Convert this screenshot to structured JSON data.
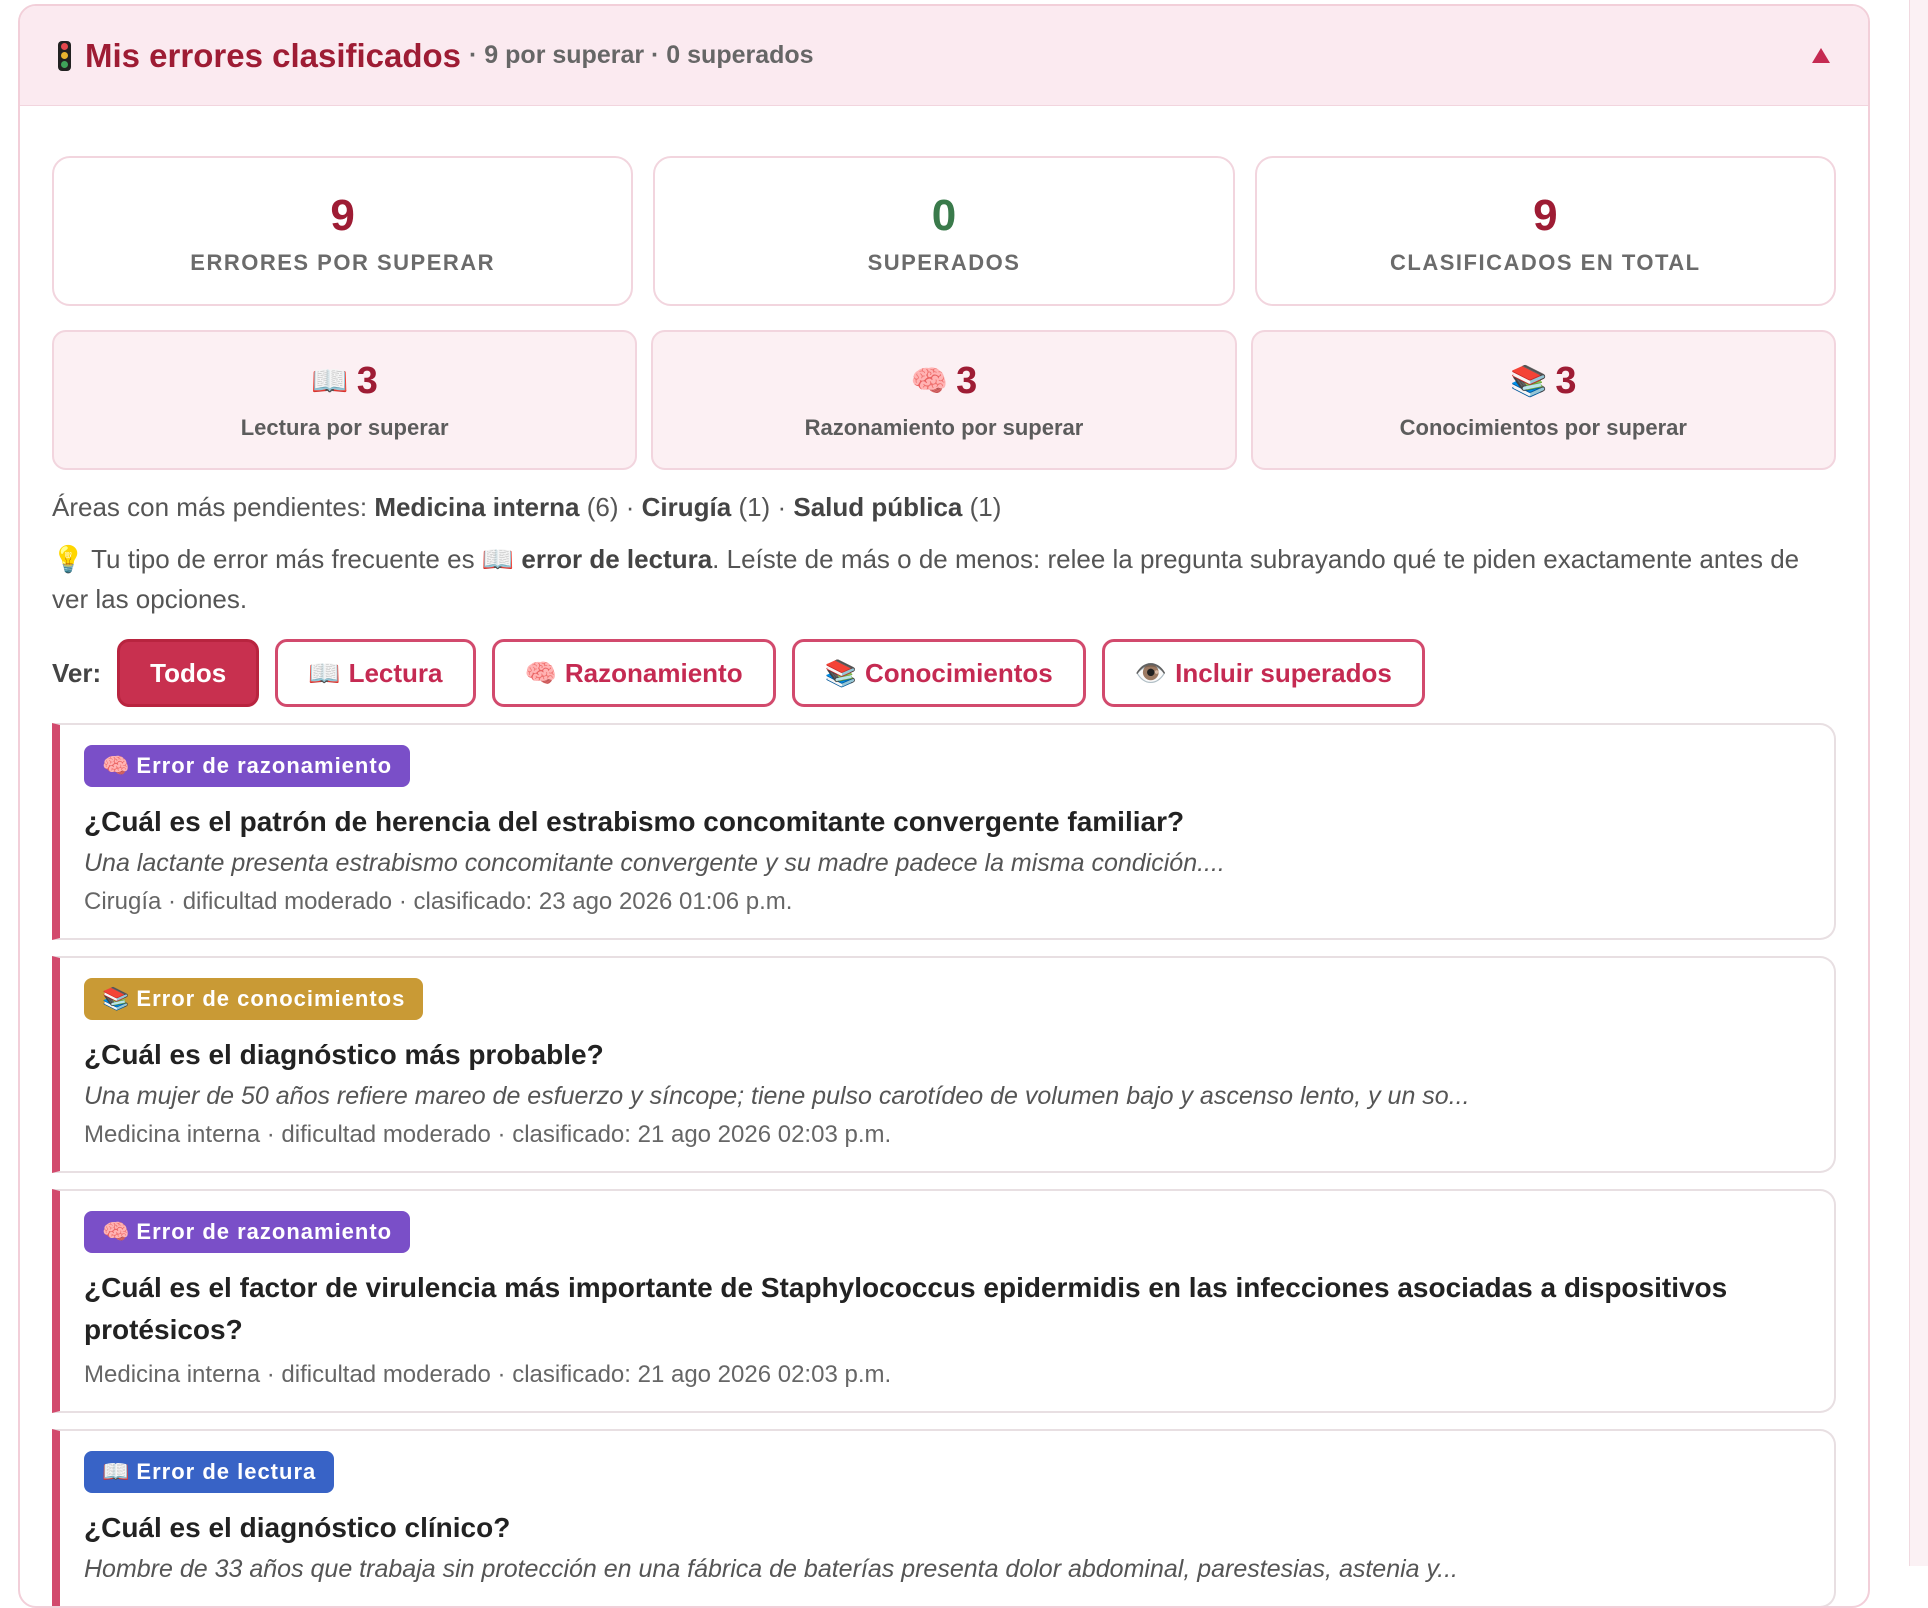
{
  "header": {
    "title": "Mis errores clasificados",
    "subtitle": "· 9 por superar · 0 superados",
    "icon": "traffic-light-icon"
  },
  "stats": [
    {
      "value": "9",
      "label": "ERRORES POR SUPERAR",
      "color": "#9e1c34"
    },
    {
      "value": "0",
      "label": "SUPERADOS",
      "color": "#3a7a4b"
    },
    {
      "value": "9",
      "label": "CLASIFICADOS EN TOTAL",
      "color": "#9e1c34"
    }
  ],
  "types": [
    {
      "icon": "📖",
      "icon_name": "open-book-icon",
      "value": "3",
      "label": "Lectura por superar"
    },
    {
      "icon": "🧠",
      "icon_name": "brain-icon",
      "value": "3",
      "label": "Razonamiento por superar"
    },
    {
      "icon": "📚",
      "icon_name": "books-icon",
      "value": "3",
      "label": "Conocimientos por superar"
    }
  ],
  "areas": {
    "prefix": "Áreas con más pendientes:",
    "items": [
      {
        "name": "Medicina interna",
        "count": "(6)"
      },
      {
        "name": "Cirugía",
        "count": "(1)"
      },
      {
        "name": "Salud pública",
        "count": "(1)"
      }
    ],
    "separator": "·"
  },
  "tip": {
    "icon": "💡",
    "prefix": "Tu tipo de error más frecuente es",
    "type_icon": "📖",
    "type_name": "error de lectura",
    "text": ". Leíste de más o de menos: relee la pregunta subrayando qué te piden exactamente antes de ver las opciones."
  },
  "filters": {
    "label": "Ver:",
    "buttons": [
      {
        "icon": "",
        "label": "Todos",
        "active": true
      },
      {
        "icon": "📖",
        "label": "Lectura",
        "active": false
      },
      {
        "icon": "🧠",
        "label": "Razonamiento",
        "active": false
      },
      {
        "icon": "📚",
        "label": "Conocimientos",
        "active": false
      },
      {
        "icon": "👁️",
        "label": "Incluir superados",
        "active": false
      }
    ]
  },
  "errors": [
    {
      "badge_icon": "🧠",
      "badge": "Error de razonamiento",
      "type": "razonamiento",
      "question": "¿Cuál es el patrón de herencia del estrabismo concomitante convergente familiar?",
      "excerpt": "Una lactante presenta estrabismo concomitante convergente y su madre padece la misma condición....",
      "meta": "Cirugía · dificultad moderado · clasificado: 23 ago 2026 01:06 p.m."
    },
    {
      "badge_icon": "📚",
      "badge": "Error de conocimientos",
      "type": "conocimientos",
      "question": "¿Cuál es el diagnóstico más probable?",
      "excerpt": "Una mujer de 50 años refiere mareo de esfuerzo y síncope; tiene pulso carotídeo de volumen bajo y ascenso lento, y un so...",
      "meta": "Medicina interna · dificultad moderado · clasificado: 21 ago 2026 02:03 p.m."
    },
    {
      "badge_icon": "🧠",
      "badge": "Error de razonamiento",
      "type": "razonamiento",
      "question": "¿Cuál es el factor de virulencia más importante de Staphylococcus epidermidis en las infecciones asociadas a dispositivos protésicos?",
      "excerpt": "",
      "meta": "Medicina interna · dificultad moderado · clasificado: 21 ago 2026 02:03 p.m."
    },
    {
      "badge_icon": "📖",
      "badge": "Error de lectura",
      "type": "lectura",
      "question": "¿Cuál es el diagnóstico clínico?",
      "excerpt": "Hombre de 33 años que trabaja sin protección en una fábrica de baterías presenta dolor abdominal, parestesias, astenia y...",
      "meta": ""
    }
  ]
}
